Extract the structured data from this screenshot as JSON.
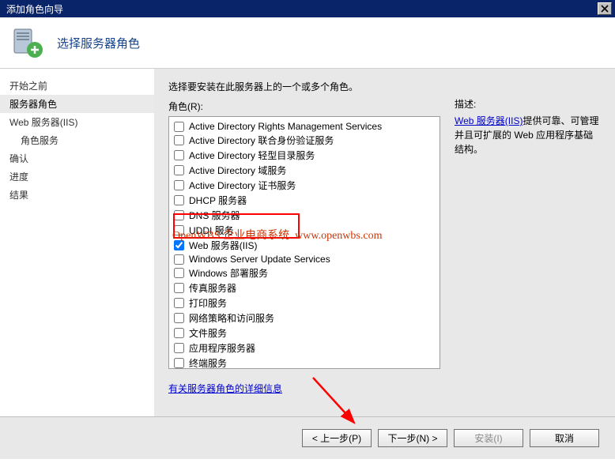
{
  "window": {
    "title": "添加角色向导"
  },
  "header": {
    "title": "选择服务器角色"
  },
  "sidebar": {
    "items": [
      {
        "label": "开始之前",
        "active": false,
        "indent": false
      },
      {
        "label": "服务器角色",
        "active": true,
        "indent": false
      },
      {
        "label": "Web 服务器(IIS)",
        "active": false,
        "indent": false
      },
      {
        "label": "角色服务",
        "active": false,
        "indent": true
      },
      {
        "label": "确认",
        "active": false,
        "indent": false
      },
      {
        "label": "进度",
        "active": false,
        "indent": false
      },
      {
        "label": "结果",
        "active": false,
        "indent": false
      }
    ]
  },
  "main": {
    "instruction": "选择要安装在此服务器上的一个或多个角色。",
    "roles_label": "角色(R):",
    "roles": [
      {
        "label": "Active Directory Rights Management Services",
        "checked": false
      },
      {
        "label": "Active Directory 联合身份验证服务",
        "checked": false
      },
      {
        "label": "Active Directory 轻型目录服务",
        "checked": false
      },
      {
        "label": "Active Directory 域服务",
        "checked": false
      },
      {
        "label": "Active Directory 证书服务",
        "checked": false
      },
      {
        "label": "DHCP 服务器",
        "checked": false
      },
      {
        "label": "DNS 服务器",
        "checked": false
      },
      {
        "label": "UDDI 服务",
        "checked": false
      },
      {
        "label": "Web 服务器(IIS)",
        "checked": true
      },
      {
        "label": "Windows Server Update Services",
        "checked": false
      },
      {
        "label": "Windows 部署服务",
        "checked": false
      },
      {
        "label": "传真服务器",
        "checked": false
      },
      {
        "label": "打印服务",
        "checked": false
      },
      {
        "label": "网络策略和访问服务",
        "checked": false
      },
      {
        "label": "文件服务",
        "checked": false
      },
      {
        "label": "应用程序服务器",
        "checked": false
      },
      {
        "label": "终端服务",
        "checked": false
      }
    ],
    "desc_label": "描述:",
    "desc_link": "Web 服务器(IIS)",
    "desc_text": "提供可靠、可管理并且可扩展的 Web 应用程序基础结构。",
    "more_link": "有关服务器角色的详细信息"
  },
  "buttons": {
    "prev": "< 上一步(P)",
    "next": "下一步(N) >",
    "install": "安装(I)",
    "cancel": "取消"
  },
  "watermark": {
    "text1": "OpenWBS 企业电商系统",
    "text2": "www.openwbs.com"
  }
}
